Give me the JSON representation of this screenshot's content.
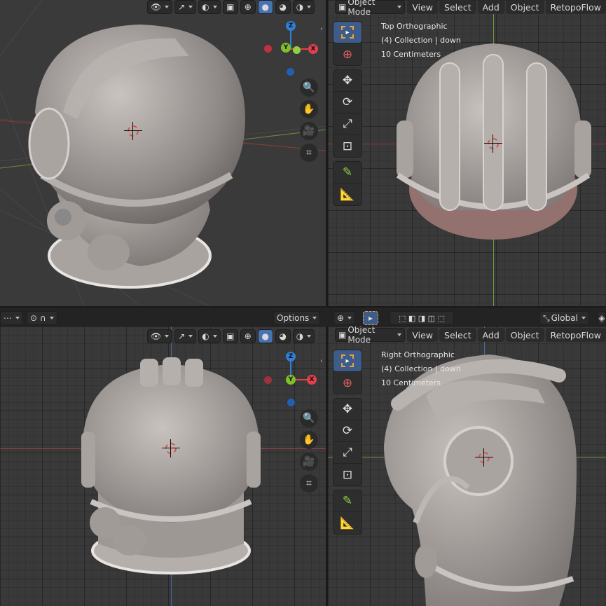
{
  "header": {
    "mode": "Object Mode",
    "menu_view": "View",
    "menu_select": "Select",
    "menu_add": "Add",
    "menu_object": "Object",
    "menu_retopoflow": "RetopoFlow",
    "options": "Options",
    "orientation": "Global"
  },
  "viewport_top": {
    "view_name": "Top Orthographic",
    "collection": "(4) Collection | down",
    "scale": "10 Centimeters"
  },
  "viewport_right": {
    "view_name": "Right Orthographic",
    "collection": "(4) Collection | down",
    "scale": "10 Centimeters"
  },
  "gizmo": {
    "z": "Z",
    "y": "Y",
    "x": "X"
  },
  "colors": {
    "x_axis": "#e2404d",
    "y_axis": "#7fbf2a",
    "z_axis": "#2e7fd6",
    "active": "#4772b3"
  },
  "icons": {
    "tools": [
      "select-box-icon",
      "cursor-icon",
      "move-icon",
      "rotate-icon",
      "scale-icon",
      "transform-icon",
      "annotate-icon",
      "measure-icon"
    ],
    "nav": [
      "zoom-icon",
      "hand-icon",
      "camera-icon",
      "grid-icon"
    ]
  }
}
